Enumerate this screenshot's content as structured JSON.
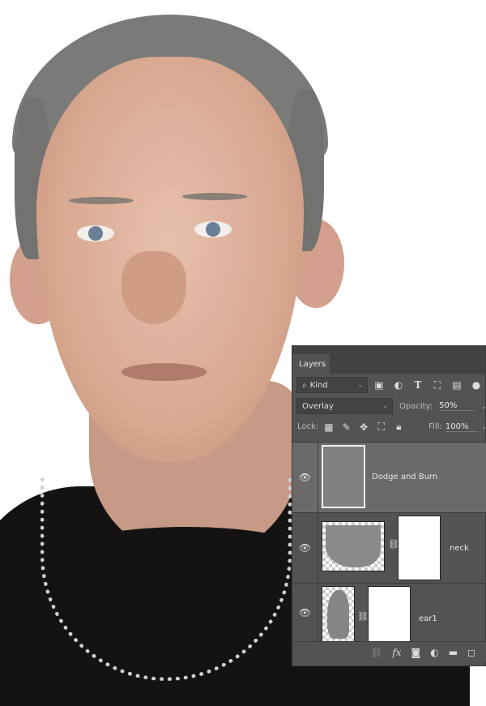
{
  "panel": {
    "tab_label": "Layers",
    "filter": {
      "value": "Kind",
      "icons": [
        "image-filter-icon",
        "adjustment-filter-icon",
        "type-filter-icon",
        "shape-filter-icon",
        "smart-object-filter-icon",
        "filter-toggle-icon"
      ]
    },
    "blend_mode": "Overlay",
    "opacity_label": "Opacity:",
    "opacity_value": "50%",
    "lock_label": "Lock:",
    "fill_label": "Fill:",
    "fill_value": "100%",
    "layers": [
      {
        "name": "Dodge and Burn",
        "visible": true,
        "selected": true
      },
      {
        "name": "neck",
        "visible": true,
        "selected": false,
        "has_mask": true
      },
      {
        "name": "ear1",
        "visible": true,
        "selected": false,
        "has_mask": true
      }
    ],
    "bottom_icons": [
      "link-layers-icon",
      "fx-icon",
      "add-mask-icon",
      "adjustment-layer-icon",
      "new-group-icon",
      "new-layer-icon"
    ],
    "fx_label": "fx"
  },
  "colors": {
    "panel_bg": "#535353",
    "selected_layer": "#6a6a6a",
    "tab_bar": "#424242"
  }
}
